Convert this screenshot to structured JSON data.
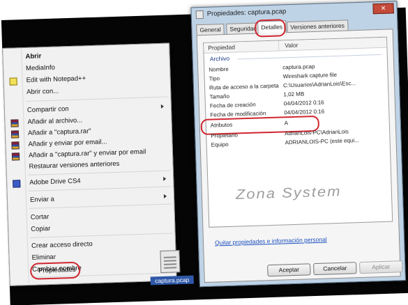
{
  "context_menu": {
    "items": [
      {
        "label": "Abrir",
        "bold": true,
        "icon": "",
        "submenu": false
      },
      {
        "label": "MediaInfo",
        "icon": "",
        "submenu": false
      },
      {
        "label": "Edit with Notepad++",
        "icon": "notepad-icon",
        "submenu": false
      },
      {
        "label": "Abrir con...",
        "icon": "",
        "submenu": false
      },
      {
        "label": "Compartir con",
        "icon": "",
        "submenu": true
      },
      {
        "label": "Añadir al archivo...",
        "icon": "winrar-icon",
        "submenu": false
      },
      {
        "label": "Añadir a \"captura.rar\"",
        "icon": "winrar-icon",
        "submenu": false
      },
      {
        "label": "Añadir y enviar por email...",
        "icon": "winrar-icon",
        "submenu": false
      },
      {
        "label": "Añadir a \"captura.rar\" y enviar por email",
        "icon": "winrar-icon",
        "submenu": false
      },
      {
        "label": "Restaurar versiones anteriores",
        "icon": "",
        "submenu": false
      },
      {
        "label": "Adobe Drive CS4",
        "icon": "adobe-drive-icon",
        "submenu": true
      },
      {
        "label": "Enviar a",
        "icon": "",
        "submenu": true
      },
      {
        "label": "Cortar",
        "icon": "",
        "submenu": false
      },
      {
        "label": "Copiar",
        "icon": "",
        "submenu": false
      },
      {
        "label": "Crear acceso directo",
        "icon": "",
        "submenu": false
      },
      {
        "label": "Eliminar",
        "icon": "",
        "submenu": false
      },
      {
        "label": "Cambiar nombre",
        "icon": "",
        "submenu": false
      },
      {
        "label": "Propiedades",
        "icon": "",
        "submenu": false,
        "highlighted": true
      }
    ]
  },
  "desktop_file": {
    "label": "captura.pcap",
    "icon": "pcap-file-icon"
  },
  "window": {
    "title": "Propiedades: captura.pcap",
    "close_label": "✕",
    "tabs": [
      {
        "label": "General"
      },
      {
        "label": "Seguridad"
      },
      {
        "label": "Detalles",
        "active": true
      },
      {
        "label": "Versiones anteriores"
      }
    ],
    "grid": {
      "col_property": "Propiedad",
      "col_value": "Valor",
      "group": "Archivo",
      "rows": [
        {
          "name": "Nombre",
          "value": "captura.pcap"
        },
        {
          "name": "Tipo",
          "value": "Wireshark capture file"
        },
        {
          "name": "Ruta de acceso a la carpeta",
          "value": "C:\\Usuarios\\AdrianLois\\Esc..."
        },
        {
          "name": "Tamaño",
          "value": "1,02 MB"
        },
        {
          "name": "Fecha de creación",
          "value": "04/04/2012 0:16"
        },
        {
          "name": "Fecha de modificación",
          "value": "04/04/2012 0:16"
        },
        {
          "name": "Atributos",
          "value": "A",
          "highlighted": true
        },
        {
          "name": "Propietario",
          "value": "AdrianLois-PC\\AdrianLois"
        },
        {
          "name": "Equipo",
          "value": "ADRIANLOIS-PC (este equi..."
        }
      ]
    },
    "remove_link": "Quitar propiedades e información personal",
    "buttons": {
      "accept": "Aceptar",
      "cancel": "Cancelar",
      "apply": "Aplicar"
    }
  },
  "watermark": "Zona System",
  "colors": {
    "highlight_ring": "#d0252f",
    "link": "#1b4fbf",
    "selection": "#2f58a8"
  }
}
